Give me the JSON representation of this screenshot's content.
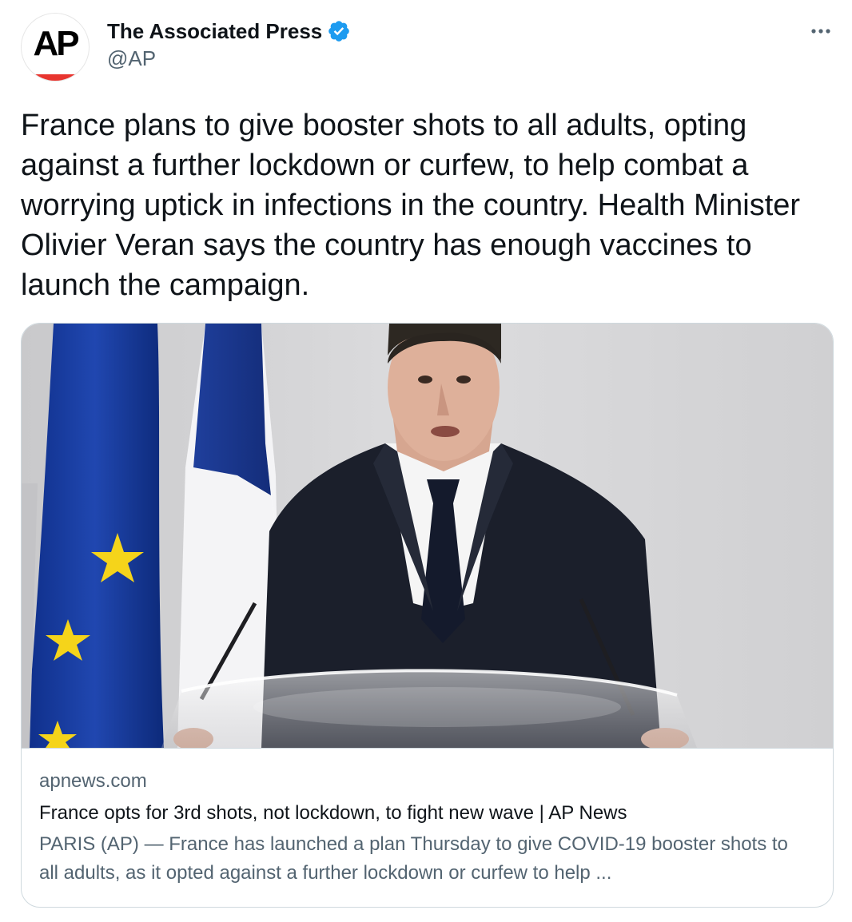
{
  "tweet": {
    "author": {
      "display_name": "The Associated Press",
      "handle": "@AP",
      "avatar_logo": "AP",
      "verified_icon": "verified-badge-icon"
    },
    "more_icon": "more-horizontal-icon",
    "text": "France plans to give booster shots to all adults, opting against a further lockdown or curfew, to help combat a worrying uptick in infections in the country. Health Minister Olivier Veran says the country has enough vaccines to launch the campaign.",
    "card": {
      "domain": "apnews.com",
      "title": "France opts for 3rd shots, not lockdown, to fight new wave | AP News",
      "description": "PARIS (AP) — France has launched a plan Thursday to give COVID-19 booster shots to all adults, as it opted against a further lockdown or curfew to help ..."
    }
  },
  "colors": {
    "primary_text": "#0f1419",
    "secondary_text": "#536471",
    "verified_blue": "#1d9bf0",
    "border": "#cfd9de",
    "ap_red": "#e8352f"
  }
}
